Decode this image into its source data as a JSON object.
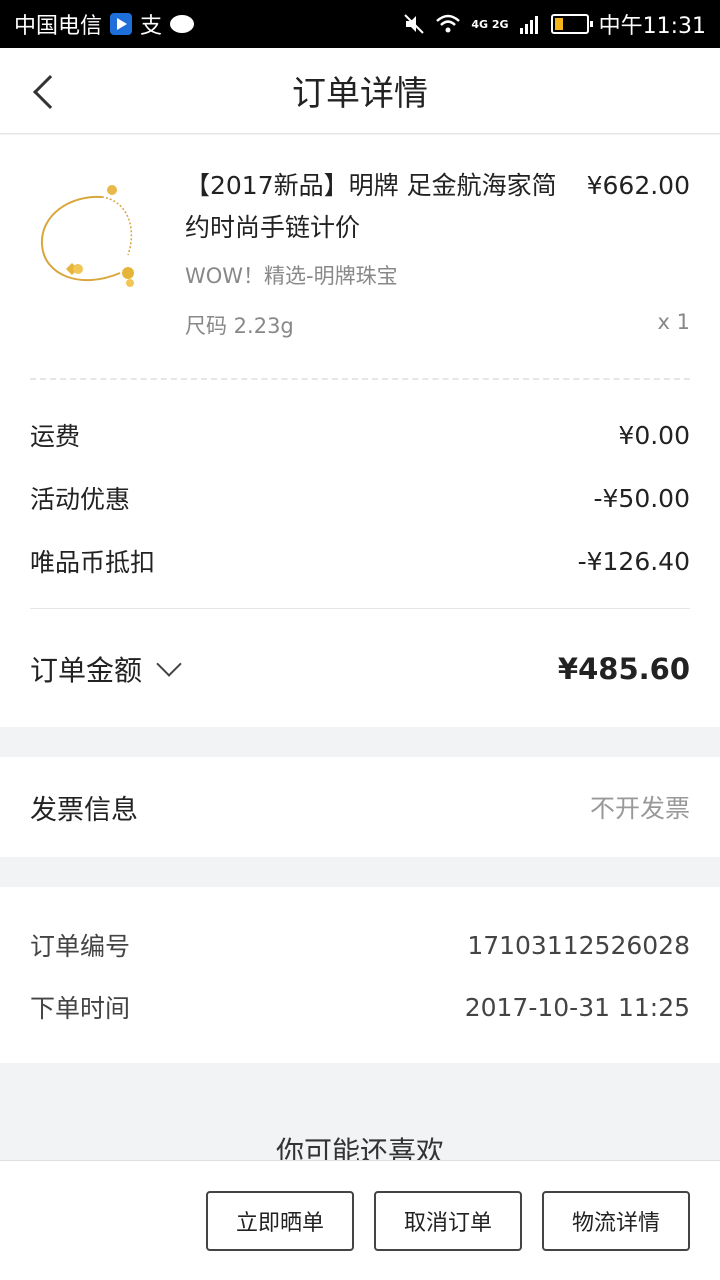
{
  "status_bar": {
    "carrier": "中国电信",
    "extra": "支",
    "network": "4G 2G",
    "time": "中午11:31"
  },
  "header": {
    "title": "订单详情",
    "back_icon": "chevron-left-icon"
  },
  "product": {
    "name": "【2017新品】明牌 足金航海家简约时尚手链计价",
    "price": "¥662.00",
    "brand": "WOW！精选-明牌珠宝",
    "size": "尺码 2.23g",
    "quantity": "x 1",
    "image_icon": "gold-bracelet-image"
  },
  "fees": [
    {
      "label": "运费",
      "value": "¥0.00"
    },
    {
      "label": "活动优惠",
      "value": "-¥50.00"
    },
    {
      "label": "唯品币抵扣",
      "value": "-¥126.40"
    }
  ],
  "total": {
    "label": "订单金额",
    "value": "¥485.60"
  },
  "invoice": {
    "label": "发票信息",
    "value": "不开发票"
  },
  "order_meta": {
    "number_label": "订单编号",
    "number_value": "17103112526028",
    "time_label": "下单时间",
    "time_value": "2017-10-31 11:25"
  },
  "recommend": {
    "title": "你可能还喜欢"
  },
  "actions": {
    "share": "立即晒单",
    "cancel": "取消订单",
    "logistics": "物流详情"
  },
  "colors": {
    "battery": "#f2b51a",
    "background": "#f2f3f5"
  }
}
